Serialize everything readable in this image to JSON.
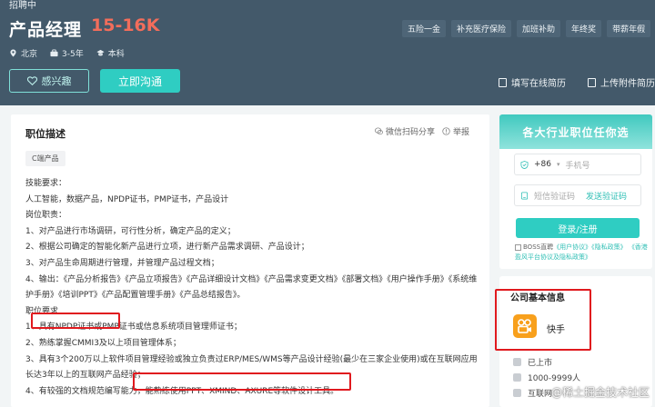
{
  "header": {
    "status": "招聘中",
    "job_title": "产品经理",
    "salary": "15-16K",
    "benefits": [
      "五险一金",
      "补充医疗保险",
      "加班补助",
      "年终奖",
      "带薪年假"
    ],
    "meta": {
      "city": "北京",
      "experience": "3-5年",
      "degree": "本科"
    },
    "interest_label": "感兴趣",
    "chat_label": "立即沟通",
    "fill_resume_label": "填写在线简历",
    "upload_resume_label": "上传附件简历"
  },
  "job": {
    "section_title": "职位描述",
    "share_label": "微信扫码分享",
    "report_label": "举报",
    "tag": "C端产品",
    "lines": [
      "技能要求：",
      "人工智能，数据产品，NPDP证书，PMP证书，产品设计",
      "岗位职责：",
      "1、对产品进行市场调研，可行性分析，确定产品的定义；",
      "2、根据公司确定的智能化新产品进行立项，进行新产品需求调研、产品设计；",
      "3、对产品生命周期进行管理，并管理产品过程文档；",
      "4、输出：《产品分析报告》《产品立项报告》《产品详细设计文档》《产品需求变更文档》《部署文档》《用户操作手册》《系统维护手册》《培训PPT》《产品配置管理手册》《产品总结报告》。",
      "职位要求",
      "1、具有NPDP证书或PMP证书或信息系统项目管理师证书；",
      "2、熟练掌握CMMI3及以上项目管理体系；",
      "3、具有3个200万以上软件项目管理经验或独立负责过ERP/MES/WMS等产品设计经验(最少在三家企业使用)或在互联网应用长达3年以上的互联网产品经验；",
      "4、有较强的文档规范编写能力，能熟练使用PPT、XMIND、AXURE等软件设计工具。"
    ]
  },
  "login": {
    "heading": "各大行业职位任你选",
    "country_code": "+86",
    "phone_placeholder": "手机号",
    "code_placeholder": "短信验证码",
    "send_code_label": "发送验证码",
    "submit_label": "登录/注册",
    "agree_prefix": "BOSS直聘",
    "agree_user": "《用户协议》",
    "agree_privacy": "《隐私政策》",
    "agree_auth": "《香港盈风平台协议及隐私政策》"
  },
  "company": {
    "section_title": "公司基本信息",
    "name": "快手",
    "stage": "已上市",
    "size": "1000-9999人",
    "industry": "互联网"
  },
  "watermark": "@稀土掘金技术社区",
  "colors": {
    "header_bg": "#43596a",
    "accent": "#2fcdc2",
    "salary": "#f26d5b",
    "highlight_box": "#e0191e"
  }
}
